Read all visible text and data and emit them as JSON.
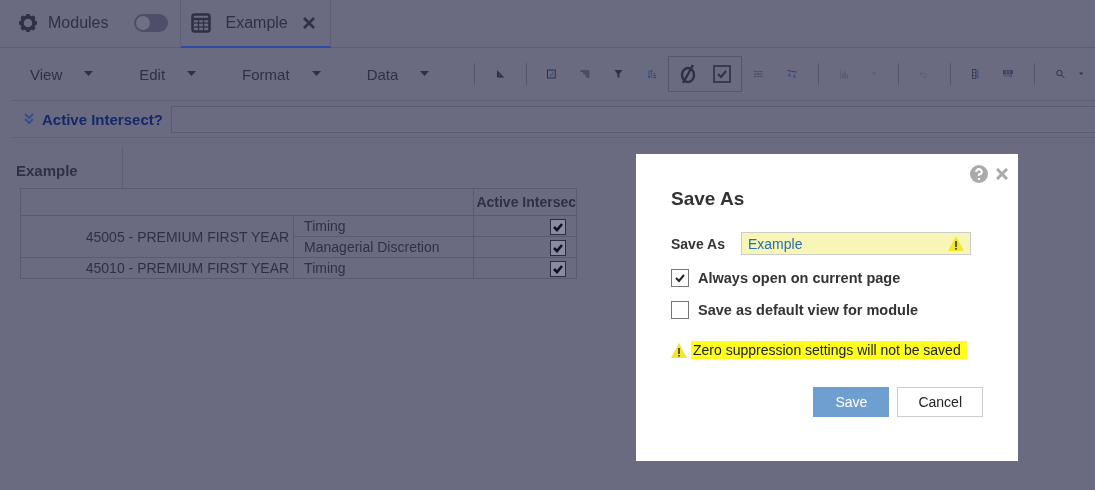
{
  "tabs": [
    {
      "label": "Modules",
      "kind": "modules",
      "toggle_on": false,
      "selected": false
    },
    {
      "label": "Example",
      "kind": "grid",
      "selected": true
    }
  ],
  "toolbar": {
    "menus": [
      "View",
      "Edit",
      "Format",
      "Data"
    ]
  },
  "filter_bar": {
    "label": "Active Intersect?"
  },
  "grid": {
    "title": "Example",
    "columns": [
      "Active Intersec"
    ],
    "rows": [
      {
        "line_item": "45005 - PREMIUM FIRST YEAR",
        "children": [
          {
            "label": "Timing",
            "checked": true
          },
          {
            "label": "Managerial Discretion",
            "checked": true
          }
        ]
      },
      {
        "line_item": "45010 - PREMIUM FIRST YEAR",
        "children": [
          {
            "label": "Timing",
            "checked": true
          }
        ]
      }
    ]
  },
  "dialog": {
    "title": "Save As",
    "name_label": "Save As",
    "name_value": "Example",
    "options": [
      {
        "label": "Always open on current page",
        "checked": true
      },
      {
        "label": "Save as default view for module",
        "checked": false
      }
    ],
    "warning": "Zero suppression settings will not be saved",
    "buttons": [
      {
        "label": "Save",
        "disabled": true
      },
      {
        "label": "Cancel",
        "disabled": false
      }
    ]
  }
}
